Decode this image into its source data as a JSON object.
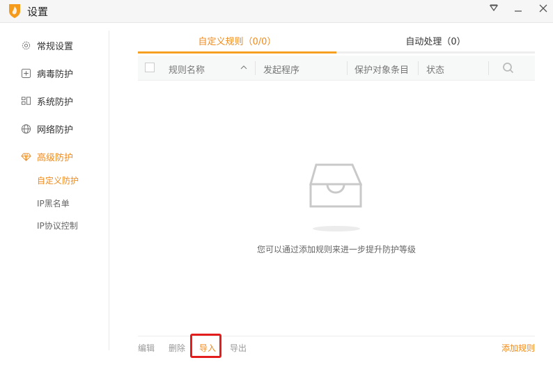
{
  "window": {
    "title": "设置",
    "colors": {
      "accent": "#f08a1c",
      "highlight": "#e31c1c"
    }
  },
  "sidebar": {
    "items": [
      {
        "label": "常规设置",
        "icon": "gear-icon"
      },
      {
        "label": "病毒防护",
        "icon": "plus-box-icon"
      },
      {
        "label": "系统防护",
        "icon": "grid-icon"
      },
      {
        "label": "网络防护",
        "icon": "globe-icon"
      },
      {
        "label": "高级防护",
        "icon": "diamond-icon"
      }
    ],
    "subitems": [
      {
        "label": "自定义防护"
      },
      {
        "label": "IP黑名单"
      },
      {
        "label": "IP协议控制"
      }
    ]
  },
  "tabs": [
    {
      "label": "自定义规则（0/0）"
    },
    {
      "label": "自动处理（0）"
    }
  ],
  "table": {
    "headers": [
      "规则名称",
      "发起程序",
      "保护对象条目",
      "状态"
    ]
  },
  "empty": {
    "message": "您可以通过添加规则来进一步提升防护等级"
  },
  "footer": {
    "edit": "编辑",
    "delete": "删除",
    "import": "导入",
    "export": "导出",
    "add": "添加规则"
  }
}
